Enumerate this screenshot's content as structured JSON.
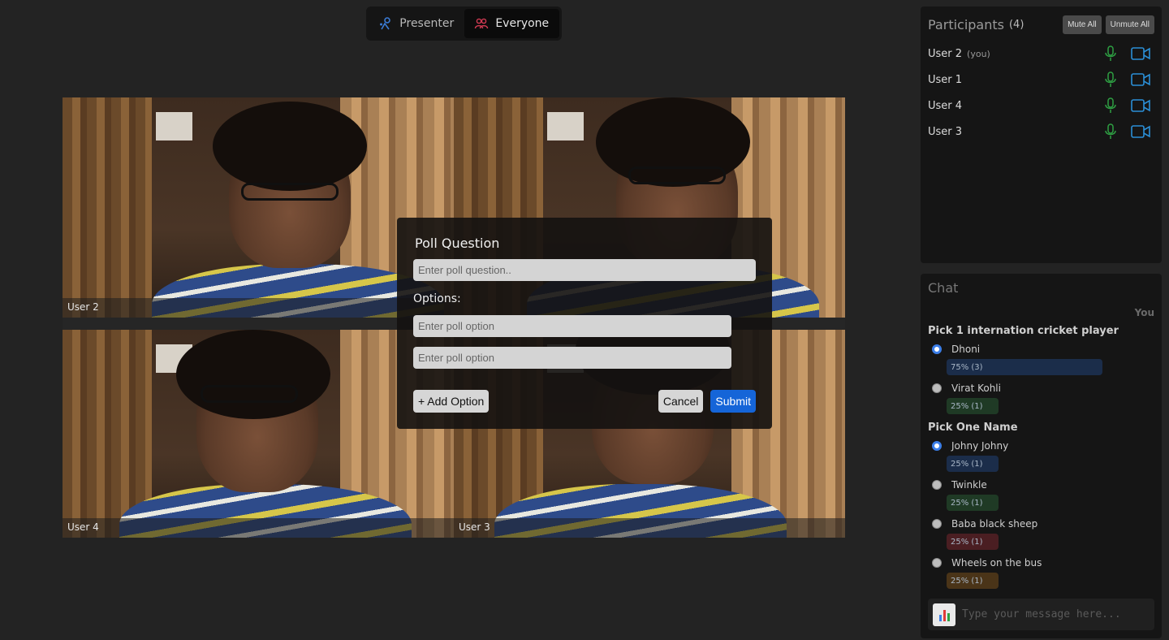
{
  "view_toggle": {
    "presenter_label": "Presenter",
    "everyone_label": "Everyone"
  },
  "video_tiles": [
    {
      "label": "User 2"
    },
    {
      "label": ""
    },
    {
      "label": "User 4"
    },
    {
      "label": "User 3"
    }
  ],
  "poll_dialog": {
    "title": "Poll Question",
    "question_placeholder": "Enter poll question..",
    "options_label": "Options:",
    "option_placeholders": [
      "Enter poll option",
      "Enter poll option"
    ],
    "add_option_label": "+ Add Option",
    "cancel_label": "Cancel",
    "submit_label": "Submit"
  },
  "participants": {
    "title": "Participants",
    "count": "(4)",
    "mute_all_label": "Mute All",
    "unmute_all_label": "Unmute All",
    "list": [
      {
        "name": "User 2",
        "tag": "(you)"
      },
      {
        "name": "User 1",
        "tag": ""
      },
      {
        "name": "User 4",
        "tag": ""
      },
      {
        "name": "User 3",
        "tag": ""
      }
    ],
    "icon_color": "#2ea043",
    "cam_color": "#2b8fd6"
  },
  "chat": {
    "title": "Chat",
    "sender": "You",
    "polls": [
      {
        "question": "Pick 1 internation cricket player",
        "options": [
          {
            "label": "Dhoni",
            "result": "75% (3)",
            "percent": 75,
            "selected": true,
            "color": "#1b2d4a"
          },
          {
            "label": "Virat Kohli",
            "result": "25% (1)",
            "percent": 25,
            "selected": false,
            "color": "#1f3a25"
          }
        ]
      },
      {
        "question": "Pick One Name",
        "options": [
          {
            "label": "Johny Johny",
            "result": "25% (1)",
            "percent": 25,
            "selected": true,
            "color": "#1b2d4a"
          },
          {
            "label": "Twinkle",
            "result": "25% (1)",
            "percent": 25,
            "selected": false,
            "color": "#1f3a25"
          },
          {
            "label": "Baba black sheep",
            "result": "25% (1)",
            "percent": 25,
            "selected": false,
            "color": "#4a1e22"
          },
          {
            "label": "Wheels on the bus",
            "result": "25% (1)",
            "percent": 25,
            "selected": false,
            "color": "#4a3418"
          }
        ]
      }
    ],
    "input_placeholder": "Type your message here..."
  }
}
